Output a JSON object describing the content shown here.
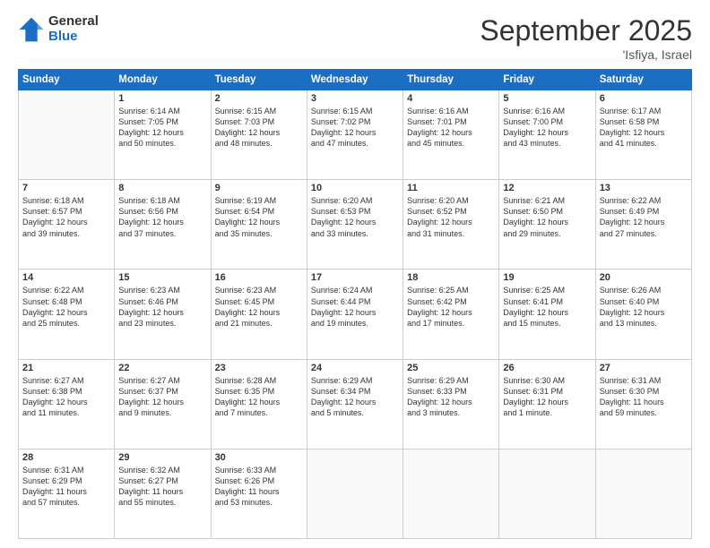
{
  "logo": {
    "general": "General",
    "blue": "Blue"
  },
  "title": "September 2025",
  "location": "'Isfiya, Israel",
  "days_of_week": [
    "Sunday",
    "Monday",
    "Tuesday",
    "Wednesday",
    "Thursday",
    "Friday",
    "Saturday"
  ],
  "weeks": [
    [
      {
        "day": "",
        "info": ""
      },
      {
        "day": "1",
        "info": "Sunrise: 6:14 AM\nSunset: 7:05 PM\nDaylight: 12 hours\nand 50 minutes."
      },
      {
        "day": "2",
        "info": "Sunrise: 6:15 AM\nSunset: 7:03 PM\nDaylight: 12 hours\nand 48 minutes."
      },
      {
        "day": "3",
        "info": "Sunrise: 6:15 AM\nSunset: 7:02 PM\nDaylight: 12 hours\nand 47 minutes."
      },
      {
        "day": "4",
        "info": "Sunrise: 6:16 AM\nSunset: 7:01 PM\nDaylight: 12 hours\nand 45 minutes."
      },
      {
        "day": "5",
        "info": "Sunrise: 6:16 AM\nSunset: 7:00 PM\nDaylight: 12 hours\nand 43 minutes."
      },
      {
        "day": "6",
        "info": "Sunrise: 6:17 AM\nSunset: 6:58 PM\nDaylight: 12 hours\nand 41 minutes."
      }
    ],
    [
      {
        "day": "7",
        "info": "Sunrise: 6:18 AM\nSunset: 6:57 PM\nDaylight: 12 hours\nand 39 minutes."
      },
      {
        "day": "8",
        "info": "Sunrise: 6:18 AM\nSunset: 6:56 PM\nDaylight: 12 hours\nand 37 minutes."
      },
      {
        "day": "9",
        "info": "Sunrise: 6:19 AM\nSunset: 6:54 PM\nDaylight: 12 hours\nand 35 minutes."
      },
      {
        "day": "10",
        "info": "Sunrise: 6:20 AM\nSunset: 6:53 PM\nDaylight: 12 hours\nand 33 minutes."
      },
      {
        "day": "11",
        "info": "Sunrise: 6:20 AM\nSunset: 6:52 PM\nDaylight: 12 hours\nand 31 minutes."
      },
      {
        "day": "12",
        "info": "Sunrise: 6:21 AM\nSunset: 6:50 PM\nDaylight: 12 hours\nand 29 minutes."
      },
      {
        "day": "13",
        "info": "Sunrise: 6:22 AM\nSunset: 6:49 PM\nDaylight: 12 hours\nand 27 minutes."
      }
    ],
    [
      {
        "day": "14",
        "info": "Sunrise: 6:22 AM\nSunset: 6:48 PM\nDaylight: 12 hours\nand 25 minutes."
      },
      {
        "day": "15",
        "info": "Sunrise: 6:23 AM\nSunset: 6:46 PM\nDaylight: 12 hours\nand 23 minutes."
      },
      {
        "day": "16",
        "info": "Sunrise: 6:23 AM\nSunset: 6:45 PM\nDaylight: 12 hours\nand 21 minutes."
      },
      {
        "day": "17",
        "info": "Sunrise: 6:24 AM\nSunset: 6:44 PM\nDaylight: 12 hours\nand 19 minutes."
      },
      {
        "day": "18",
        "info": "Sunrise: 6:25 AM\nSunset: 6:42 PM\nDaylight: 12 hours\nand 17 minutes."
      },
      {
        "day": "19",
        "info": "Sunrise: 6:25 AM\nSunset: 6:41 PM\nDaylight: 12 hours\nand 15 minutes."
      },
      {
        "day": "20",
        "info": "Sunrise: 6:26 AM\nSunset: 6:40 PM\nDaylight: 12 hours\nand 13 minutes."
      }
    ],
    [
      {
        "day": "21",
        "info": "Sunrise: 6:27 AM\nSunset: 6:38 PM\nDaylight: 12 hours\nand 11 minutes."
      },
      {
        "day": "22",
        "info": "Sunrise: 6:27 AM\nSunset: 6:37 PM\nDaylight: 12 hours\nand 9 minutes."
      },
      {
        "day": "23",
        "info": "Sunrise: 6:28 AM\nSunset: 6:35 PM\nDaylight: 12 hours\nand 7 minutes."
      },
      {
        "day": "24",
        "info": "Sunrise: 6:29 AM\nSunset: 6:34 PM\nDaylight: 12 hours\nand 5 minutes."
      },
      {
        "day": "25",
        "info": "Sunrise: 6:29 AM\nSunset: 6:33 PM\nDaylight: 12 hours\nand 3 minutes."
      },
      {
        "day": "26",
        "info": "Sunrise: 6:30 AM\nSunset: 6:31 PM\nDaylight: 12 hours\nand 1 minute."
      },
      {
        "day": "27",
        "info": "Sunrise: 6:31 AM\nSunset: 6:30 PM\nDaylight: 11 hours\nand 59 minutes."
      }
    ],
    [
      {
        "day": "28",
        "info": "Sunrise: 6:31 AM\nSunset: 6:29 PM\nDaylight: 11 hours\nand 57 minutes."
      },
      {
        "day": "29",
        "info": "Sunrise: 6:32 AM\nSunset: 6:27 PM\nDaylight: 11 hours\nand 55 minutes."
      },
      {
        "day": "30",
        "info": "Sunrise: 6:33 AM\nSunset: 6:26 PM\nDaylight: 11 hours\nand 53 minutes."
      },
      {
        "day": "",
        "info": ""
      },
      {
        "day": "",
        "info": ""
      },
      {
        "day": "",
        "info": ""
      },
      {
        "day": "",
        "info": ""
      }
    ]
  ]
}
